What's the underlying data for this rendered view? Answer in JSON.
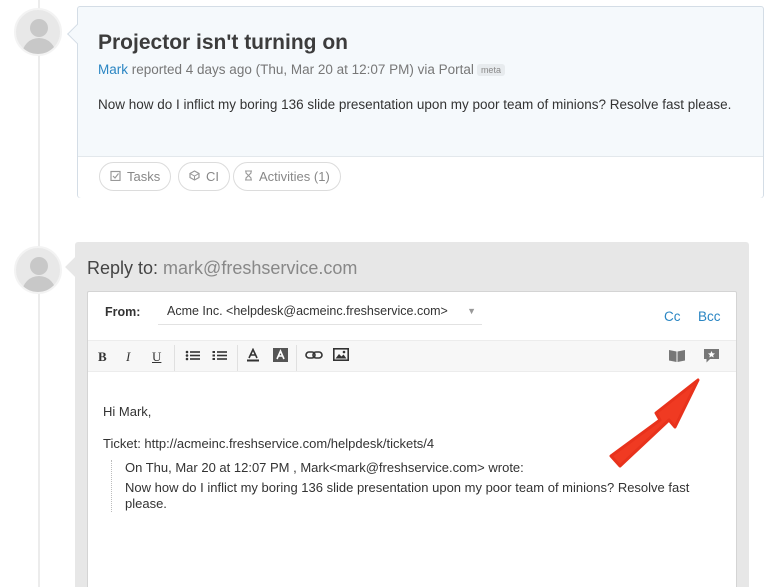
{
  "ticket": {
    "title": "Projector isn't turning on",
    "author": "Mark",
    "reported_text": " reported 4 days ago (Thu, Mar 20 at 12:07 PM) via Portal",
    "meta_badge": "meta",
    "body": "Now how do I inflict my boring 136 slide presentation upon my poor team of minions? Resolve fast please.",
    "actions": {
      "tasks": "Tasks",
      "ci": "CI",
      "activities": "Activities (1)"
    }
  },
  "reply": {
    "prefix": "Reply to: ",
    "email": "mark@freshservice.com",
    "from_label": "From:",
    "from_value": "Acme Inc. <helpdesk@acmeinc.freshservice.com>",
    "cc": "Cc",
    "bcc": "Bcc",
    "toolbar": {
      "bold": "B",
      "italic": "I",
      "underline": "U"
    },
    "greeting": "Hi Mark,",
    "ticket_line": "Ticket: http://acmeinc.freshservice.com/helpdesk/tickets/4",
    "quote_attribution": "On Thu, Mar 20 at 12:07 PM , Mark<mark@freshservice.com> wrote:",
    "quote_body": "Now how do I inflict my boring 136 slide presentation upon my poor team of minions? Resolve fast please."
  },
  "colors": {
    "link": "#2b86c3",
    "annotation_arrow": "#f03a22",
    "ticket_card_bg": "#f5f9fc",
    "reply_card_bg": "#e7e7e7"
  },
  "icons": [
    "user-avatar-icon",
    "tasks-icon",
    "ci-icon",
    "hourglass-icon",
    "bullet-list-icon",
    "numbered-list-icon",
    "text-color-icon",
    "background-color-icon",
    "link-icon",
    "image-icon",
    "solutions-book-icon",
    "canned-response-icon",
    "annotation-arrow"
  ]
}
